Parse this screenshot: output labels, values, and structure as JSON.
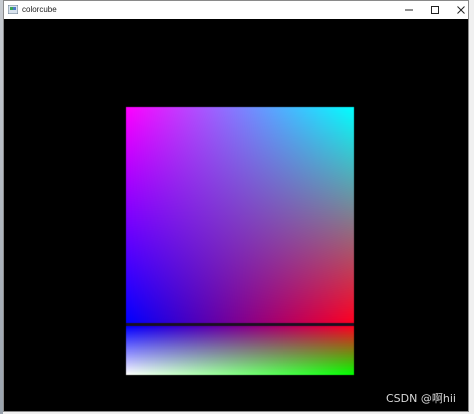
{
  "window": {
    "title": "colorcube",
    "controls": {
      "minimize": "minimize",
      "maximize": "maximize",
      "close": "close"
    }
  },
  "scene": {
    "background": "#000000",
    "face_corners": {
      "top_left": "#ff00ff",
      "top_right": "#00ffff",
      "bottom_left": "#0000ff",
      "bottom_right": "#ff0020"
    },
    "bottom_face_corners": {
      "top_left": "#0000ff",
      "top_right": "#ff0020",
      "bottom_left": "#ffffff",
      "bottom_right": "#00ff00"
    }
  },
  "watermark": {
    "text": "CSDN @啊hii"
  }
}
